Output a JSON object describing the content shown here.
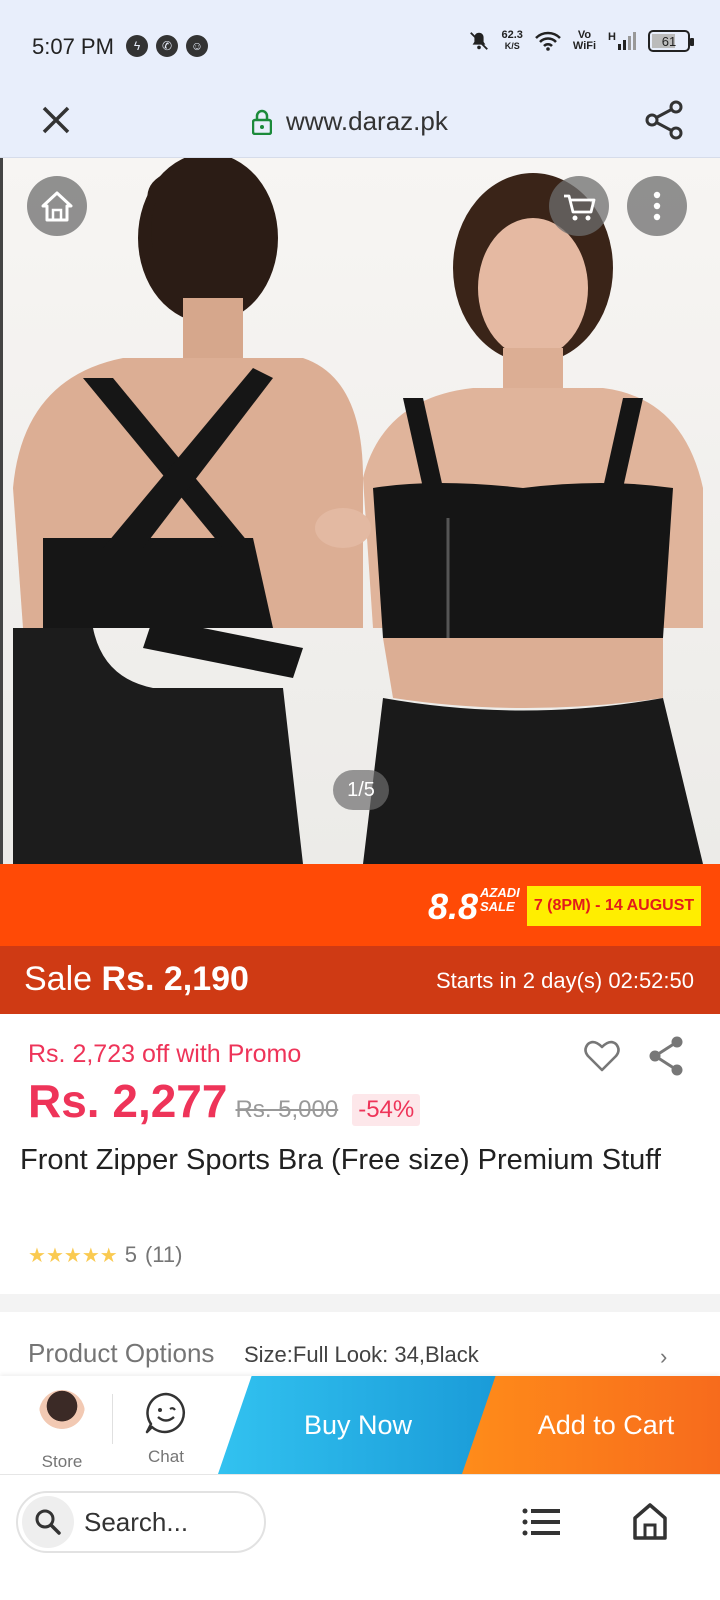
{
  "status_bar": {
    "time": "5:07 PM",
    "speed_value": "62.3",
    "speed_unit": "K/S",
    "vowifi_top": "Vo",
    "vowifi_bottom": "WiFi",
    "network": "H",
    "battery": "61"
  },
  "url_bar": {
    "url": "www.daraz.pk"
  },
  "gallery": {
    "counter": "1/5"
  },
  "campaign": {
    "big": "8.8",
    "azadi": "AZADI",
    "sale": "SALE",
    "date": "7 (8PM) - 14 AUGUST"
  },
  "sale_bar": {
    "label": "Sale",
    "price": "Rs. 2,190",
    "countdown": "Starts in 2 day(s) 02:52:50"
  },
  "product": {
    "promo": "Rs. 2,723 off with Promo",
    "price": "Rs. 2,277",
    "original_price": "Rs. 5,000",
    "discount": "-54%",
    "title": "Front Zipper Sports Bra (Free size) Premium Stuff",
    "rating": "5",
    "rating_count": "(11)"
  },
  "options": {
    "label": "Product Options",
    "value": "Size:Full Look: 34,Black"
  },
  "action_bar": {
    "store": "Store",
    "chat": "Chat",
    "buy_now": "Buy Now",
    "add_to_cart": "Add to Cart"
  },
  "browser_bar": {
    "search_placeholder": "Search..."
  },
  "colors": {
    "accent": "#ee3459",
    "campaign": "#ff4a06",
    "sale_bar": "#cf3a14",
    "buy_now": "#1a9bd8",
    "add_to_cart": "#f76b1c"
  }
}
